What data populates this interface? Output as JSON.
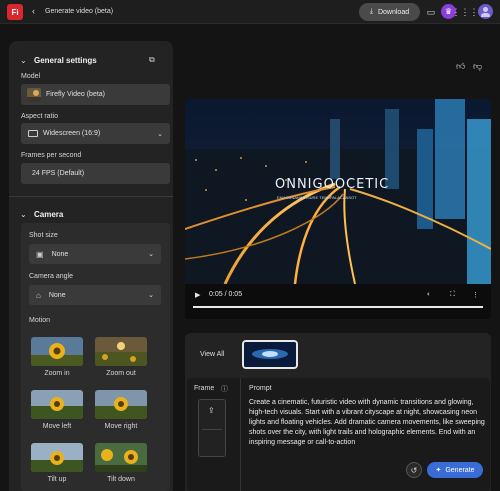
{
  "app": {
    "logo_text": "Fi",
    "title": "Generate video (beta)",
    "download_label": "Download"
  },
  "general": {
    "section_title": "General settings",
    "model_label": "Model",
    "model_value": "Firefly Video (beta)",
    "aspect_label": "Aspect ratio",
    "aspect_value": "Widescreen (16:9)",
    "fps_label": "Frames per second",
    "fps_value": "24 FPS (Default)"
  },
  "camera": {
    "section_title": "Camera",
    "shot_size_label": "Shot size",
    "shot_size_value": "None",
    "angle_label": "Camera angle",
    "angle_value": "None",
    "motion_label": "Motion",
    "motions": [
      {
        "label": "Zoom in"
      },
      {
        "label": "Zoom out"
      },
      {
        "label": "Move left"
      },
      {
        "label": "Move right"
      },
      {
        "label": "Tilt up"
      },
      {
        "label": "Tilt down"
      }
    ]
  },
  "video": {
    "overlay_title": "ONNIGOOCETIC",
    "overlay_subtitle": "ENHOUNANIMASURE TENUPALACANSOT",
    "time": "0:05 / 0:05",
    "progress_fraction": 1.0
  },
  "bottom": {
    "view_all_label": "View All",
    "frame_label": "Frame",
    "prompt_label": "Prompt",
    "prompt_text": "Create a cinematic, futuristic video with dynamic transitions and glowing, high-tech visuals. Start with a vibrant cityscape at night, showcasing neon lights and floating vehicles. Add dramatic camera movements, like sweeping shots over the city, with light trails and holographic elements. End with an inspiring message or call-to-action",
    "generate_label": "Generate"
  },
  "colors": {
    "accent": "#3a6cd8",
    "brand": "#d8282d",
    "panel": "#232323",
    "background": "#141414"
  }
}
